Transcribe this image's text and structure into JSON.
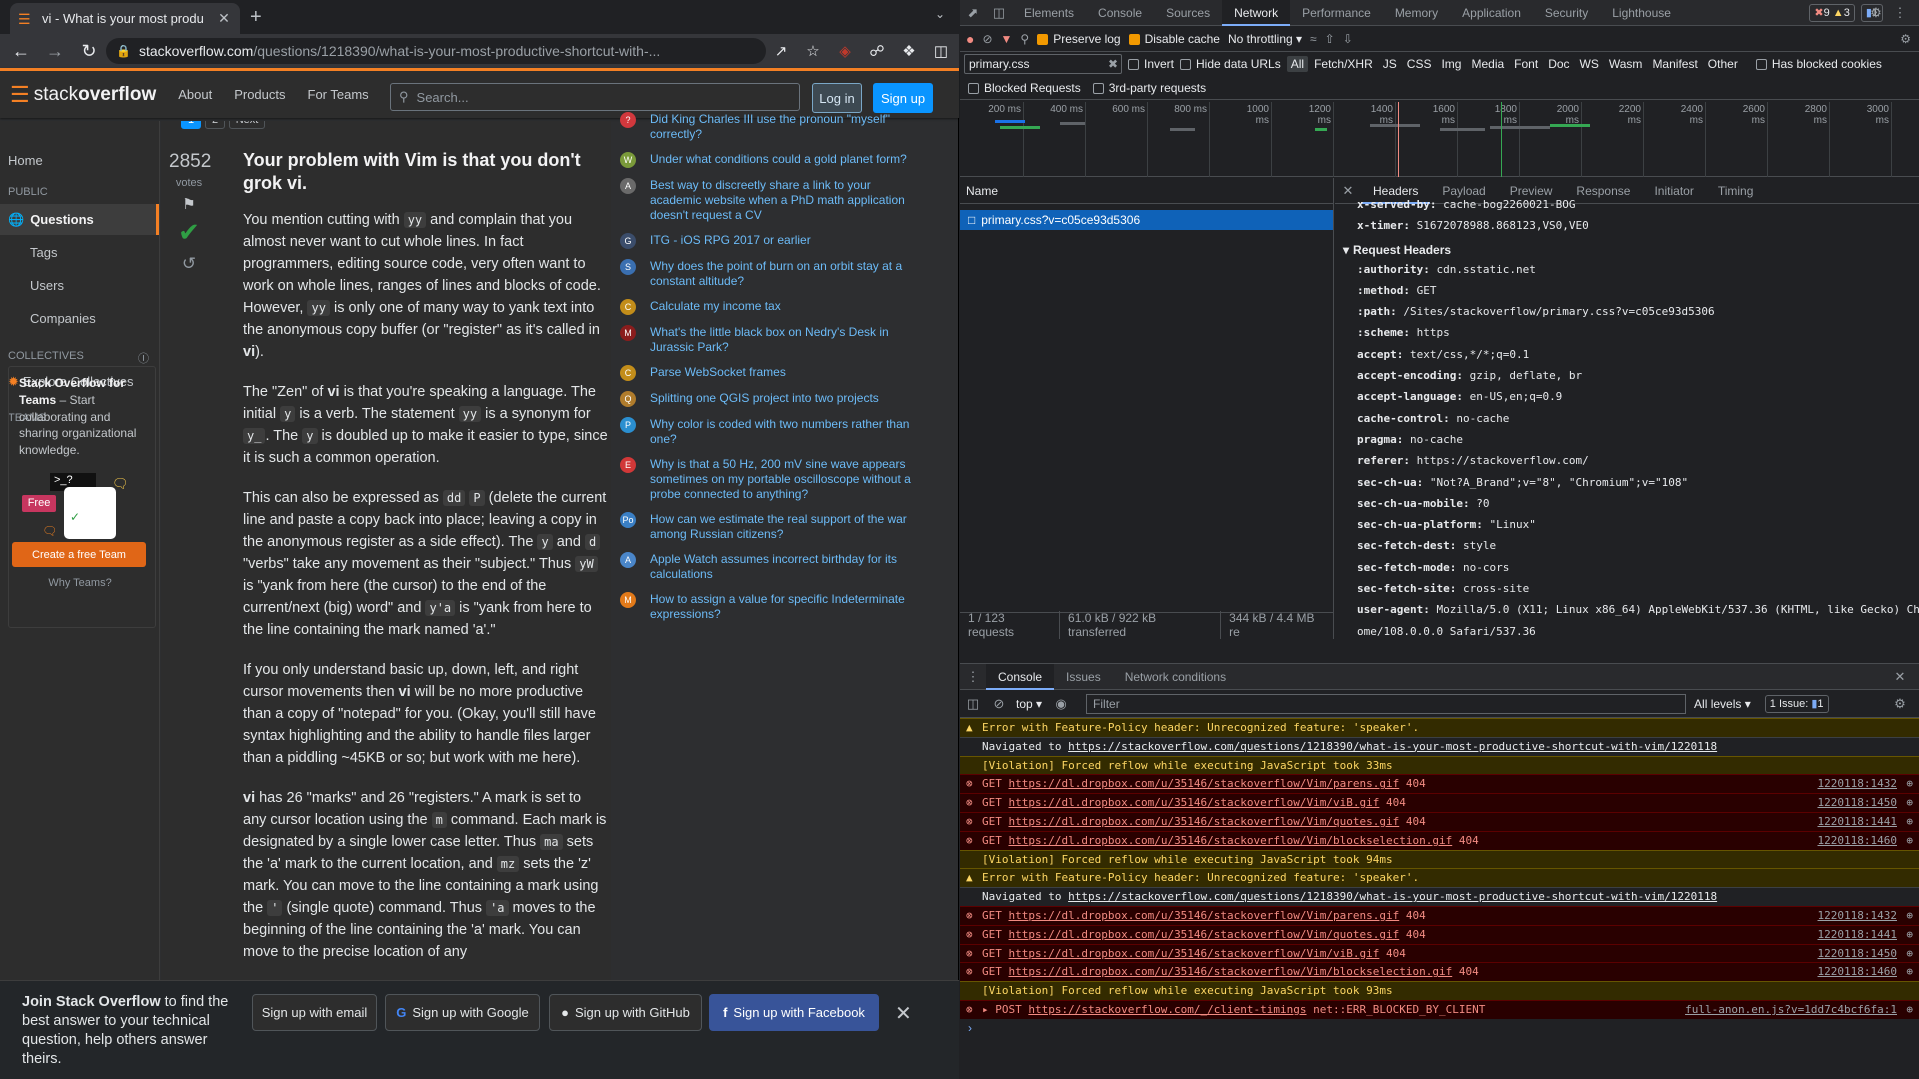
{
  "tab": {
    "title": "vi - What is your most produ"
  },
  "address": {
    "host": "stackoverflow.com",
    "path": "/questions/1218390/what-is-your-most-productive-shortcut-with-..."
  },
  "so_nav": {
    "logo_text": "stack",
    "logo_bold": "overflow",
    "about": "About",
    "products": "Products",
    "for_teams": "For Teams",
    "search_placeholder": "Search...",
    "login": "Log in",
    "signup": "Sign up"
  },
  "left_nav": {
    "home": "Home",
    "public": "PUBLIC",
    "questions": "Questions",
    "tags": "Tags",
    "users": "Users",
    "companies": "Companies",
    "collectives": "COLLECTIVES",
    "explore": "Explore Collectives",
    "teams": "TEAMS",
    "teams_title": "Stack Overflow for Teams",
    "teams_body": " – Start collaborating and sharing organizational knowledge.",
    "free": "Free",
    "prompt": ">_?",
    "cta": "Create a free Team",
    "why": "Why Teams?"
  },
  "answer": {
    "votes": "2852",
    "votes_label": "votes",
    "title": "Your problem with Vim is that you don't grok vi.",
    "p1": [
      "You mention cutting with ",
      "yy",
      " and complain that you almost never want to cut whole lines. In fact programmers, editing source code, very often want to work on whole lines, ranges of lines and blocks of code. However, ",
      "yy",
      " is only one of many way to yank text into the anonymous copy buffer (or \"register\" as it's called in ",
      "vi",
      ")."
    ],
    "p2": [
      "The \"Zen\" of ",
      "vi",
      " is that you're speaking a language. The initial ",
      "y",
      " is a verb. The statement ",
      "yy",
      " is a synonym for ",
      "y_",
      ". The ",
      "y",
      " is doubled up to make it easier to type, since it is such a common operation."
    ],
    "p3": [
      "This can also be expressed as ",
      "dd",
      " ",
      "P",
      " (delete the current line and paste a copy back into place; leaving a copy in the anonymous register as a side effect). The ",
      "y",
      " and ",
      "d",
      " \"verbs\" take any movement as their \"subject.\" Thus ",
      "yW",
      " is \"yank from here (the cursor) to the end of the current/next (big) word\" and ",
      "y'a",
      " is \"yank from here to the line containing the mark named 'a'.\""
    ],
    "p4": [
      "If you only understand basic up, down, left, and right cursor movements then ",
      "vi",
      " will be no more productive than a copy of \"notepad\" for you. (Okay, you'll still have syntax highlighting and the ability to handle files larger than a piddling ~45KB or so; but work with me here)."
    ],
    "p5": [
      "vi",
      " has 26 \"marks\" and 26 \"registers.\" A mark is set to any cursor location using the ",
      "m",
      " command. Each mark is designated by a single lower case letter. Thus ",
      "ma",
      " sets the 'a' mark to the current location, and ",
      "mz",
      " sets the 'z' mark. You can move to the line containing a mark using the ",
      "'",
      " (single quote) command. Thus ",
      "'a",
      " moves to the beginning of the line containing the 'a' mark. You can move to the precise location of any"
    ]
  },
  "pager": {
    "a": "1",
    "b": "2",
    "next": "Next"
  },
  "hot_questions": [
    {
      "text": "Did King Charles III use the pronoun \"myself\" correctly?",
      "color": "#d1383d",
      "ic": "?"
    },
    {
      "text": "Under what conditions could a gold planet form?",
      "color": "#7a9a3a",
      "ic": "W"
    },
    {
      "text": "Best way to discreetly share a link to your academic website when a PhD math application doesn't request a CV",
      "color": "#6a6a6a",
      "ic": "A"
    },
    {
      "text": "ITG - iOS RPG 2017 or earlier",
      "color": "#3b4d6b",
      "ic": "G"
    },
    {
      "text": "Why does the point of burn on an orbit stay at a constant altitude?",
      "color": "#3a6fb0",
      "ic": "S"
    },
    {
      "text": "Calculate my income tax",
      "color": "#c28d1a",
      "ic": "C"
    },
    {
      "text": "What's the little black box on Nedry's Desk in Jurassic Park?",
      "color": "#8a1d1d",
      "ic": "M"
    },
    {
      "text": "Parse WebSocket frames",
      "color": "#c28d1a",
      "ic": "C"
    },
    {
      "text": "Splitting one QGIS project into two projects",
      "color": "#b07c2c",
      "ic": "Q"
    },
    {
      "text": "Why color is coded with two numbers rather than one?",
      "color": "#2b8fd0",
      "ic": "P"
    },
    {
      "text": "Why is that a 50 Hz, 200 mV sine wave appears sometimes on my portable oscilloscope without a probe connected to anything?",
      "color": "#d13838",
      "ic": "E"
    },
    {
      "text": "How can we estimate the real support of the war among Russian citizens?",
      "color": "#3a7fc4",
      "ic": "Po"
    },
    {
      "text": "Apple Watch assumes incorrect birthday for its calculations",
      "color": "#4a86c9",
      "ic": "A"
    },
    {
      "text": "How to assign a value for specific Indeterminate expressions?",
      "color": "#e27a1a",
      "ic": "M"
    }
  ],
  "banner": {
    "bold": "Join Stack Overflow",
    "text": " to find the best answer to your technical question, help others answer theirs.",
    "email": "Sign up with email",
    "google": "Sign up with Google",
    "github": "Sign up with GitHub",
    "facebook": "Sign up with Facebook"
  },
  "devtools": {
    "tabs": [
      "Elements",
      "Console",
      "Sources",
      "Network",
      "Performance",
      "Memory",
      "Application",
      "Security",
      "Lighthouse"
    ],
    "errors": "9",
    "warnings": "3",
    "issues": "1",
    "preserve_log": "Preserve log",
    "disable_cache": "Disable cache",
    "throttle": "No throttling",
    "filter_value": "primary.css",
    "invert": "Invert",
    "hide_data": "Hide data URLs",
    "types": [
      "All",
      "Fetch/XHR",
      "JS",
      "CSS",
      "Img",
      "Media",
      "Font",
      "Doc",
      "WS",
      "Wasm",
      "Manifest",
      "Other"
    ],
    "blocked_cookies": "Has blocked cookies",
    "blocked_requests": "Blocked Requests",
    "third_party": "3rd-party requests",
    "ticks": [
      "200 ms",
      "400 ms",
      "600 ms",
      "800 ms",
      "1000 ms",
      "1200 ms",
      "1400 ms",
      "1600 ms",
      "1800 ms",
      "2000 ms",
      "2200 ms",
      "2400 ms",
      "2600 ms",
      "2800 ms",
      "3000 ms"
    ],
    "name_header": "Name",
    "request": "primary.css?v=c05ce93d5306",
    "status": [
      "1 / 123 requests",
      "61.0 kB / 922 kB transferred",
      "344 kB / 4.4 MB re"
    ],
    "detail_tabs": [
      "Headers",
      "Payload",
      "Preview",
      "Response",
      "Initiator",
      "Timing"
    ],
    "resp_headers": [
      [
        "x-served-by:",
        "cache-bog2260021-BOG"
      ],
      [
        "x-timer:",
        "S1672078988.868123,VS0,VE0"
      ]
    ],
    "req_title": "Request Headers",
    "req_headers": [
      [
        ":authority:",
        "cdn.sstatic.net"
      ],
      [
        ":method:",
        "GET"
      ],
      [
        ":path:",
        "/Sites/stackoverflow/primary.css?v=c05ce93d5306"
      ],
      [
        ":scheme:",
        "https"
      ],
      [
        "accept:",
        "text/css,*/*;q=0.1"
      ],
      [
        "accept-encoding:",
        "gzip, deflate, br"
      ],
      [
        "accept-language:",
        "en-US,en;q=0.9"
      ],
      [
        "cache-control:",
        "no-cache"
      ],
      [
        "pragma:",
        "no-cache"
      ],
      [
        "referer:",
        "https://stackoverflow.com/"
      ],
      [
        "sec-ch-ua:",
        "\"Not?A_Brand\";v=\"8\", \"Chromium\";v=\"108\""
      ],
      [
        "sec-ch-ua-mobile:",
        "?0"
      ],
      [
        "sec-ch-ua-platform:",
        "\"Linux\""
      ],
      [
        "sec-fetch-dest:",
        "style"
      ],
      [
        "sec-fetch-mode:",
        "no-cors"
      ],
      [
        "sec-fetch-site:",
        "cross-site"
      ],
      [
        "user-agent:",
        "Mozilla/5.0 (X11; Linux x86_64) AppleWebKit/537.36 (KHTML, like Gecko) Chr"
      ]
    ],
    "ua_cont": "ome/108.0.0.0 Safari/537.36",
    "drawer_tabs": [
      "Console",
      "Issues",
      "Network conditions"
    ],
    "context": "top",
    "cfilter": "Filter",
    "levels": "All levels",
    "issue_badge": "1 Issue:",
    "issue_count": "1",
    "messages": [
      {
        "k": "warn",
        "t": "Error with Feature-Policy header: Unrecognized feature: 'speaker'."
      },
      {
        "k": "info",
        "pre": "Navigated to ",
        "link": "https://stackoverflow.com/questions/1218390/what-is-your-most-productive-shortcut-with-vim/1220118"
      },
      {
        "k": "warn",
        "t": "[Violation] Forced reflow while executing JavaScript took 33ms"
      },
      {
        "k": "err",
        "pre": "GET ",
        "link": "https://dl.dropbox.com/u/35146/stackoverflow/Vim/parens.gif",
        "post": " 404",
        "src": "1220118:1432"
      },
      {
        "k": "err",
        "pre": "GET ",
        "link": "https://dl.dropbox.com/u/35146/stackoverflow/Vim/viB.gif",
        "post": " 404",
        "src": "1220118:1450"
      },
      {
        "k": "err",
        "pre": "GET ",
        "link": "https://dl.dropbox.com/u/35146/stackoverflow/Vim/quotes.gif",
        "post": " 404",
        "src": "1220118:1441"
      },
      {
        "k": "err",
        "pre": "GET ",
        "link": "https://dl.dropbox.com/u/35146/stackoverflow/Vim/blockselection.gif",
        "post": " 404",
        "src": "1220118:1460"
      },
      {
        "k": "warn",
        "t": "[Violation] Forced reflow while executing JavaScript took 94ms"
      },
      {
        "k": "warn",
        "t": "Error with Feature-Policy header: Unrecognized feature: 'speaker'."
      },
      {
        "k": "info",
        "pre": "Navigated to ",
        "link": "https://stackoverflow.com/questions/1218390/what-is-your-most-productive-shortcut-with-vim/1220118"
      },
      {
        "k": "err",
        "pre": "GET ",
        "link": "https://dl.dropbox.com/u/35146/stackoverflow/Vim/parens.gif",
        "post": " 404",
        "src": "1220118:1432"
      },
      {
        "k": "err",
        "pre": "GET ",
        "link": "https://dl.dropbox.com/u/35146/stackoverflow/Vim/quotes.gif",
        "post": " 404",
        "src": "1220118:1441"
      },
      {
        "k": "err",
        "pre": "GET ",
        "link": "https://dl.dropbox.com/u/35146/stackoverflow/Vim/viB.gif",
        "post": " 404",
        "src": "1220118:1450"
      },
      {
        "k": "err",
        "pre": "GET ",
        "link": "https://dl.dropbox.com/u/35146/stackoverflow/Vim/blockselection.gif",
        "post": " 404",
        "src": "1220118:1460"
      },
      {
        "k": "warn",
        "t": "[Violation] Forced reflow while executing JavaScript took 93ms"
      },
      {
        "k": "err",
        "pre": "▸ POST ",
        "link": "https://stackoverflow.com/_/client-timings",
        "post": " net::ERR_BLOCKED_BY_CLIENT",
        "src": "full-anon.en.js?v=1dd7c4bcf6fa:1"
      }
    ]
  }
}
